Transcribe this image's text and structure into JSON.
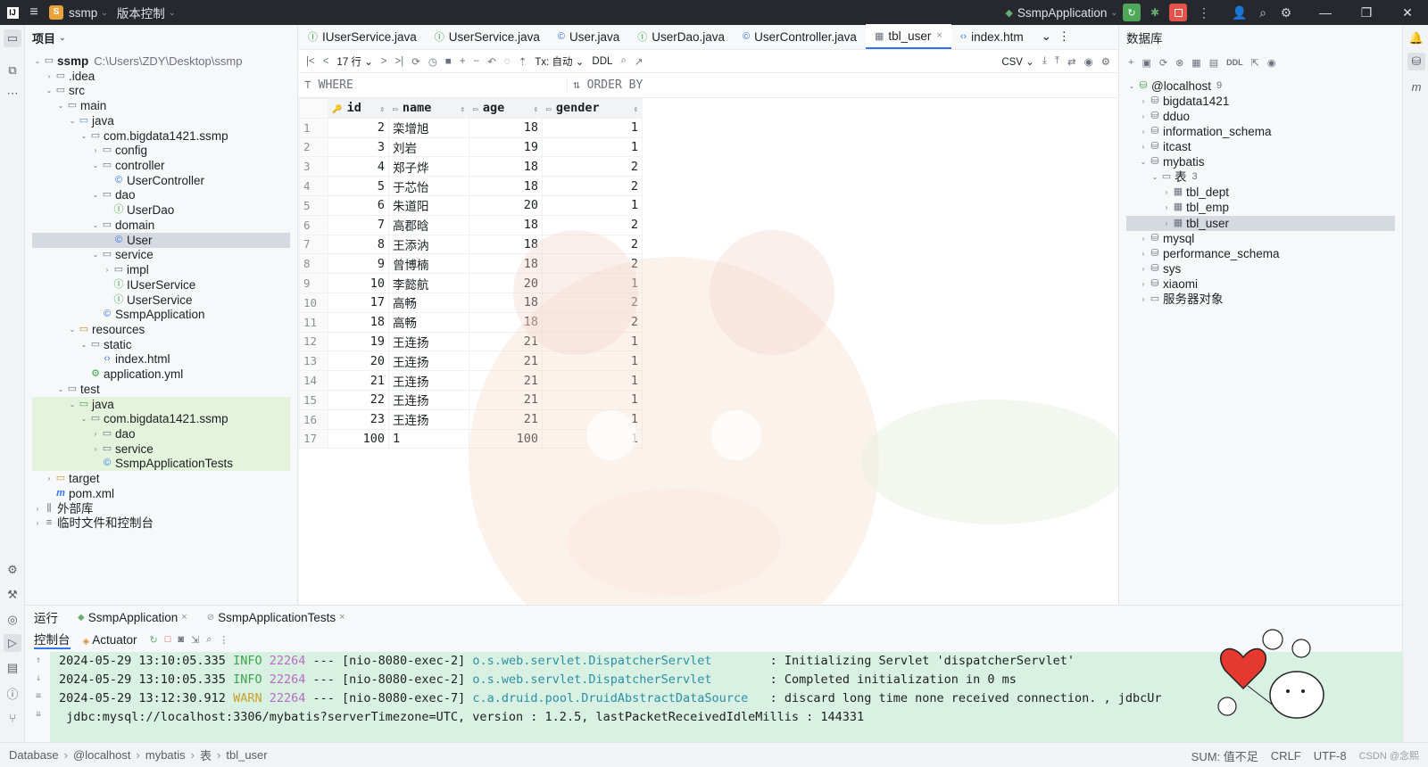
{
  "titlebar": {
    "project": "ssmp",
    "project_badge": "S",
    "vcs": "版本控制",
    "run_config": "SsmpApplication"
  },
  "project_panel": {
    "title": "项目",
    "tree": [
      {
        "label": "ssmp",
        "extra": "C:\\Users\\ZDY\\Desktop\\ssmp",
        "depth": 0,
        "open": true,
        "icon": "folder-icon",
        "bold": true
      },
      {
        "label": ".idea",
        "depth": 1,
        "open": false,
        "icon": "folder-icon"
      },
      {
        "label": "src",
        "depth": 1,
        "open": true,
        "icon": "folder-icon"
      },
      {
        "label": "main",
        "depth": 2,
        "open": true,
        "icon": "folder-icon"
      },
      {
        "label": "java",
        "depth": 3,
        "open": true,
        "icon": "source-folder-icon"
      },
      {
        "label": "com.bigdata1421.ssmp",
        "depth": 4,
        "open": true,
        "icon": "package-icon"
      },
      {
        "label": "config",
        "depth": 5,
        "open": false,
        "icon": "package-icon"
      },
      {
        "label": "controller",
        "depth": 5,
        "open": true,
        "icon": "package-icon"
      },
      {
        "label": "UserController",
        "depth": 6,
        "icon": "class-icon"
      },
      {
        "label": "dao",
        "depth": 5,
        "open": true,
        "icon": "package-icon"
      },
      {
        "label": "UserDao",
        "depth": 6,
        "icon": "interface-icon"
      },
      {
        "label": "domain",
        "depth": 5,
        "open": true,
        "icon": "package-icon"
      },
      {
        "label": "User",
        "depth": 6,
        "icon": "class-icon",
        "selected": true
      },
      {
        "label": "service",
        "depth": 5,
        "open": true,
        "icon": "package-icon"
      },
      {
        "label": "impl",
        "depth": 6,
        "open": false,
        "icon": "package-icon"
      },
      {
        "label": "IUserService",
        "depth": 6,
        "icon": "interface-icon"
      },
      {
        "label": "UserService",
        "depth": 6,
        "icon": "interface-icon"
      },
      {
        "label": "SsmpApplication",
        "depth": 5,
        "icon": "class-icon"
      },
      {
        "label": "resources",
        "depth": 3,
        "open": true,
        "icon": "resources-folder-icon"
      },
      {
        "label": "static",
        "depth": 4,
        "open": true,
        "icon": "folder-icon"
      },
      {
        "label": "index.html",
        "depth": 5,
        "icon": "html-file-icon"
      },
      {
        "label": "application.yml",
        "depth": 4,
        "icon": "yaml-file-icon"
      },
      {
        "label": "test",
        "depth": 2,
        "open": true,
        "icon": "folder-icon"
      },
      {
        "label": "java",
        "depth": 3,
        "open": true,
        "icon": "test-source-folder-icon",
        "test": true
      },
      {
        "label": "com.bigdata1421.ssmp",
        "depth": 4,
        "open": true,
        "icon": "package-icon",
        "test": true
      },
      {
        "label": "dao",
        "depth": 5,
        "open": false,
        "icon": "package-icon",
        "test": true
      },
      {
        "label": "service",
        "depth": 5,
        "open": false,
        "icon": "package-icon",
        "test": true
      },
      {
        "label": "SsmpApplicationTests",
        "depth": 5,
        "icon": "class-icon",
        "test": true
      },
      {
        "label": "target",
        "depth": 1,
        "open": false,
        "icon": "target-folder-icon"
      },
      {
        "label": "pom.xml",
        "depth": 1,
        "icon": "maven-icon"
      },
      {
        "label": "外部库",
        "depth": 0,
        "open": false,
        "icon": "library-icon"
      },
      {
        "label": "临时文件和控制台",
        "depth": 0,
        "open": false,
        "icon": "scratch-icon"
      }
    ]
  },
  "editor": {
    "tabs": [
      {
        "label": "IUserService.java",
        "icon": "interface-icon"
      },
      {
        "label": "UserService.java",
        "icon": "interface-icon"
      },
      {
        "label": "User.java",
        "icon": "class-icon"
      },
      {
        "label": "UserDao.java",
        "icon": "interface-icon"
      },
      {
        "label": "UserController.java",
        "icon": "class-icon"
      },
      {
        "label": "tbl_user",
        "icon": "table-icon",
        "active": true
      },
      {
        "label": "index.htm",
        "icon": "html-file-icon"
      }
    ],
    "toolbar": {
      "rows": "17 行",
      "tx": "Tx: 自动",
      "ddl": "DDL",
      "export": "CSV"
    },
    "where": "WHERE",
    "order_by": "ORDER BY",
    "columns": [
      "id",
      "name",
      "age",
      "gender"
    ],
    "rows": [
      {
        "n": "1",
        "id": "2",
        "name": "栾增旭",
        "age": "18",
        "gender": "1"
      },
      {
        "n": "2",
        "id": "3",
        "name": "刘岩",
        "age": "19",
        "gender": "1"
      },
      {
        "n": "3",
        "id": "4",
        "name": "郑子烨",
        "age": "18",
        "gender": "2"
      },
      {
        "n": "4",
        "id": "5",
        "name": "于芯怡",
        "age": "18",
        "gender": "2"
      },
      {
        "n": "5",
        "id": "6",
        "name": "朱道阳",
        "age": "20",
        "gender": "1"
      },
      {
        "n": "6",
        "id": "7",
        "name": "高郡晗",
        "age": "18",
        "gender": "2"
      },
      {
        "n": "7",
        "id": "8",
        "name": "王添汭",
        "age": "18",
        "gender": "2"
      },
      {
        "n": "8",
        "id": "9",
        "name": "曾博楠",
        "age": "18",
        "gender": "2"
      },
      {
        "n": "9",
        "id": "10",
        "name": "李懿航",
        "age": "20",
        "gender": "1"
      },
      {
        "n": "10",
        "id": "17",
        "name": "高畅",
        "age": "18",
        "gender": "2"
      },
      {
        "n": "11",
        "id": "18",
        "name": "高畅",
        "age": "18",
        "gender": "2"
      },
      {
        "n": "12",
        "id": "19",
        "name": "王连扬",
        "age": "21",
        "gender": "1"
      },
      {
        "n": "13",
        "id": "20",
        "name": "王连扬",
        "age": "21",
        "gender": "1"
      },
      {
        "n": "14",
        "id": "21",
        "name": "王连扬",
        "age": "21",
        "gender": "1"
      },
      {
        "n": "15",
        "id": "22",
        "name": "王连扬",
        "age": "21",
        "gender": "1"
      },
      {
        "n": "16",
        "id": "23",
        "name": "王连扬",
        "age": "21",
        "gender": "1"
      },
      {
        "n": "17",
        "id": "100",
        "name": "1",
        "age": "100",
        "gender": "1"
      }
    ]
  },
  "db_panel": {
    "title": "数据库",
    "tree": [
      {
        "label": "@localhost",
        "count": "9",
        "depth": 0,
        "open": true,
        "icon": "datasource-icon"
      },
      {
        "label": "bigdata1421",
        "depth": 1,
        "open": false,
        "icon": "schema-icon"
      },
      {
        "label": "dduo",
        "depth": 1,
        "open": false,
        "icon": "schema-icon"
      },
      {
        "label": "information_schema",
        "depth": 1,
        "open": false,
        "icon": "schema-icon"
      },
      {
        "label": "itcast",
        "depth": 1,
        "open": false,
        "icon": "schema-icon"
      },
      {
        "label": "mybatis",
        "depth": 1,
        "open": true,
        "icon": "schema-icon"
      },
      {
        "label": "表",
        "count": "3",
        "depth": 2,
        "open": true,
        "icon": "folder-icon"
      },
      {
        "label": "tbl_dept",
        "depth": 3,
        "open": false,
        "icon": "table-icon"
      },
      {
        "label": "tbl_emp",
        "depth": 3,
        "open": false,
        "icon": "table-icon"
      },
      {
        "label": "tbl_user",
        "depth": 3,
        "open": false,
        "icon": "table-icon",
        "selected": true
      },
      {
        "label": "mysql",
        "depth": 1,
        "open": false,
        "icon": "schema-icon"
      },
      {
        "label": "performance_schema",
        "depth": 1,
        "open": false,
        "icon": "schema-icon"
      },
      {
        "label": "sys",
        "depth": 1,
        "open": false,
        "icon": "schema-icon"
      },
      {
        "label": "xiaomi",
        "depth": 1,
        "open": false,
        "icon": "schema-icon"
      },
      {
        "label": "服务器对象",
        "depth": 1,
        "open": false,
        "icon": "folder-icon"
      }
    ]
  },
  "run_panel": {
    "title": "运行",
    "tabs": [
      "SsmpApplication",
      "SsmpApplicationTests"
    ],
    "console_tab": "控制台",
    "actuator_tab": "Actuator",
    "lines": [
      {
        "ts": "2024-05-29 13:10:05.335",
        "level": "INFO",
        "pid": "22264",
        "thread": "--- [nio-8080-exec-2]",
        "logger": "o.s.web.servlet.DispatcherServlet       ",
        "msg": ": Initializing Servlet 'dispatcherServlet'"
      },
      {
        "ts": "2024-05-29 13:10:05.335",
        "level": "INFO",
        "pid": "22264",
        "thread": "--- [nio-8080-exec-2]",
        "logger": "o.s.web.servlet.DispatcherServlet       ",
        "msg": ": Completed initialization in 0 ms"
      },
      {
        "ts": "2024-05-29 13:12:30.912",
        "level": "WARN",
        "pid": "22264",
        "thread": "--- [nio-8080-exec-7]",
        "logger": "c.a.druid.pool.DruidAbstractDataSource  ",
        "msg": ": discard long time none received connection. , jdbcUr"
      }
    ],
    "continuation": " jdbc:mysql://localhost:3306/mybatis?serverTimezone=UTC, version : 1.2.5, lastPacketReceivedIdleMillis : 144331"
  },
  "statusbar": {
    "crumbs": [
      "Database",
      "@localhost",
      "mybatis",
      "表",
      "tbl_user"
    ],
    "sum": "SUM: 值不足",
    "eol": "CRLF",
    "encoding": "UTF-8",
    "watermark": "CSDN @念熙"
  },
  "colors": {
    "accent": "#3574f0",
    "titlebar": "#27282e",
    "run_green": "#4fa85a",
    "stop_red": "#e5534b",
    "console_bg": "#d8f1e2"
  }
}
